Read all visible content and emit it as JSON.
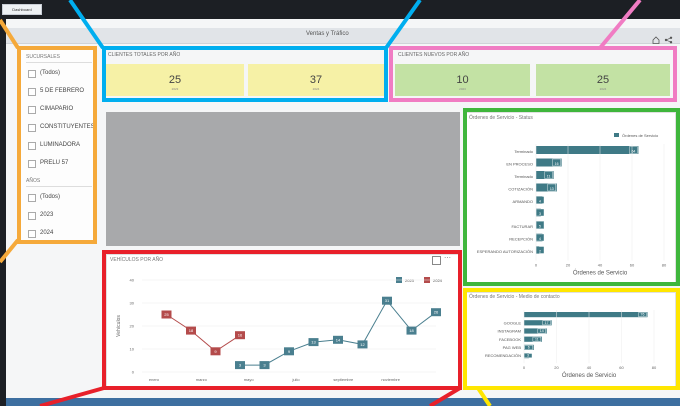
{
  "tab": {
    "label": "Dashboard"
  },
  "header": {
    "title": "Ventas y Tráfico"
  },
  "filters": {
    "sucursales_title": "SUCURSALES",
    "sucursales": [
      "(Todos)",
      "5 DE FEBRERO",
      "CIMAPARIO",
      "CONSTITUYENTES",
      "LUMINADORA",
      "PRELU 57"
    ],
    "anos_title": "AÑOS",
    "anos": [
      "(Todos)",
      "2023",
      "2024"
    ]
  },
  "kpi_totales": {
    "title": "CLIENTES TOTALES POR AÑO",
    "values": [
      "25",
      "37"
    ],
    "sub": [
      "2023",
      "2024"
    ]
  },
  "kpi_nuevos": {
    "title": "CLIENTES NUEVOS POR AÑO",
    "values": [
      "10",
      "25"
    ],
    "sub": [
      "2023",
      "2024"
    ]
  },
  "colors": {
    "blue_callout": "#00aeef",
    "pink_callout": "#f07cc3",
    "orange_callout": "#f5a93a",
    "green_callout": "#3fb63c",
    "red_callout": "#e8202a",
    "yellow_callout": "#ffe600",
    "series_2023": "#4a7f8f",
    "series_2024": "#b44b4b",
    "bar": "#3f7a86"
  },
  "chart_data": [
    {
      "type": "bar",
      "title": "Órdenes de Servicio - Status",
      "legend": "Órdenes de Servicio",
      "xlabel": "Órdenes de Servicio",
      "categories": [
        "Terminado",
        "EN PROCESO",
        "Terminado",
        "COTIZACIÓN",
        "ARMANDO",
        "",
        "FACTURAR",
        "RECEPCIÓN",
        "ESPERANDO AUTORIZACIÓN"
      ],
      "values": [
        64,
        16,
        11,
        13,
        4,
        3,
        5,
        4,
        2
      ],
      "xticks": [
        "0",
        "20",
        "40",
        "60",
        "80"
      ],
      "xlim": [
        0,
        80
      ]
    },
    {
      "type": "line",
      "title": "VEHÍCULOS POR AÑO",
      "ylabel": "Vehículos",
      "x": [
        "enero",
        "febrero",
        "marzo",
        "abril",
        "mayo",
        "junio",
        "julio",
        "agosto",
        "septiembre",
        "octubre",
        "noviembre",
        "diciembre"
      ],
      "xticks": [
        "enero",
        "marzo",
        "mayo",
        "julio",
        "septiembre",
        "noviembre"
      ],
      "yticks": [
        "0",
        "10",
        "20",
        "30",
        "40"
      ],
      "ylim": [
        0,
        40
      ],
      "series": [
        {
          "name": "2023",
          "values": [
            null,
            null,
            null,
            null,
            null,
            3,
            3,
            9,
            13,
            14,
            12,
            31,
            18,
            26
          ]
        },
        {
          "name": "2024",
          "values": [
            null,
            null,
            25,
            18,
            9,
            16
          ]
        }
      ],
      "points_2023": [
        [
          5,
          3
        ],
        [
          6,
          3
        ],
        [
          7,
          9
        ],
        [
          8,
          13
        ],
        [
          9,
          14
        ],
        [
          10,
          12
        ],
        [
          11,
          31
        ],
        [
          12,
          18
        ],
        [
          13,
          26
        ]
      ],
      "labels_2023": [
        "3",
        "3",
        "9",
        "13",
        "14",
        "12",
        "31",
        "18",
        "26"
      ],
      "points_2024": [
        [
          2,
          25
        ],
        [
          3,
          18
        ],
        [
          4,
          9
        ],
        [
          5,
          16
        ]
      ],
      "labels_2024": [
        "25",
        "18",
        "9",
        "16"
      ]
    },
    {
      "type": "bar",
      "title": "Órdenes de Servicio - Medio de contacto",
      "xlabel": "Órdenes de Servicio",
      "categories": [
        "",
        "GOOGLE",
        "INSTAGRAM",
        "FACEBOOK",
        "PAG WEB",
        "RECOMENDACIÓN"
      ],
      "values": [
        76,
        17,
        14,
        11,
        6,
        3
      ],
      "xticks": [
        "0",
        "20",
        "40",
        "60",
        "80"
      ],
      "xlim": [
        0,
        80
      ]
    }
  ]
}
